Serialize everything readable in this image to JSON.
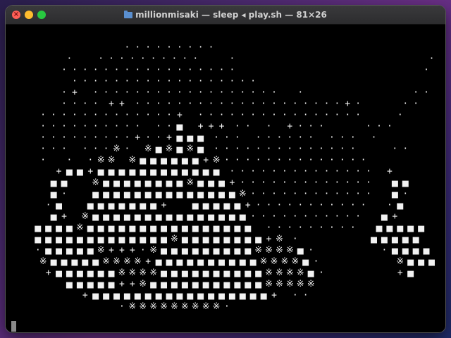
{
  "window": {
    "title": "millionmisaki — sleep ◂ play.sh — 81×26",
    "close_glyph": "×"
  },
  "terminal": {
    "glyphs": {
      ".": "·",
      "+": "+",
      "x": "※",
      "#": "■"
    },
    "art_lines": [
      "                      . . . . . . . . .",
      "           .     . . . . . . . . . .      .                                     .",
      "          . . . . . . . . . . . . . . . . .                                    .",
      "            . . . . . . . . . . . . . . . . . .",
      "          . +   . . . . . . . . . . . . . . . . . .    .                     . .",
      "          . . . .  + +  . . . . . . . . . . . . . . . . . . . . + .        . .",
      "      . . . . . . . . . . . . . +   . . . . . . . . . . . . . . . .       .",
      "      . . . . . . . . . .   . . #   + + +  . .   .   + . . .        . . .",
      "      . . . . . . . . . + . . + # # #  . . .   . . . . . .   . . .   .",
      "      . . .   . . . x .   x # x # x #  . . . . . . . . . . . . . .       . .",
      "      .    .   . x x   x # # # # # # + x . . . . . . . . . . . . . .",
      "         + # # + # # # # # # # # # # # #  . . . . . . . . . . . . . .   +",
      "        # #     x # # # # # # # # x # # # + . . . . . . . . . . . . .    # #",
      "        # .     # # # # # # # # # # # # # # x . . . . . . . . . . . .    # .",
      "       . #     # # # # # # # +     # # # # # + . . . . . . . . . . .    . #",
      "        # +   x # # # # # # # # # # # # # # # . . . . . . . . . . .    # +",
      "     # # # # x # # # # # # # # # # # # # # # #   . . . . . . . . .    # # # # #",
      "     # # # # # # # # # # # # # x # # # # # # # # + x  .              # # # # #",
      "     . # # # # # x + + + . x # # # # # # # # # x x x x # .             . # # # #",
      "      x # # # # # x x x x + # # # # # # # # # # x x x x # .               x # # #",
      "       + # # # # # # x x x x # # # # # # # # # # x x x x # .              + #",
      "           # # # # # + + x # # # # # # # # # # # x x x x x",
      "              + # # # # # # # # # # # # # # # # # +   . .",
      "                     . x x x x x x x x x ."
    ]
  }
}
